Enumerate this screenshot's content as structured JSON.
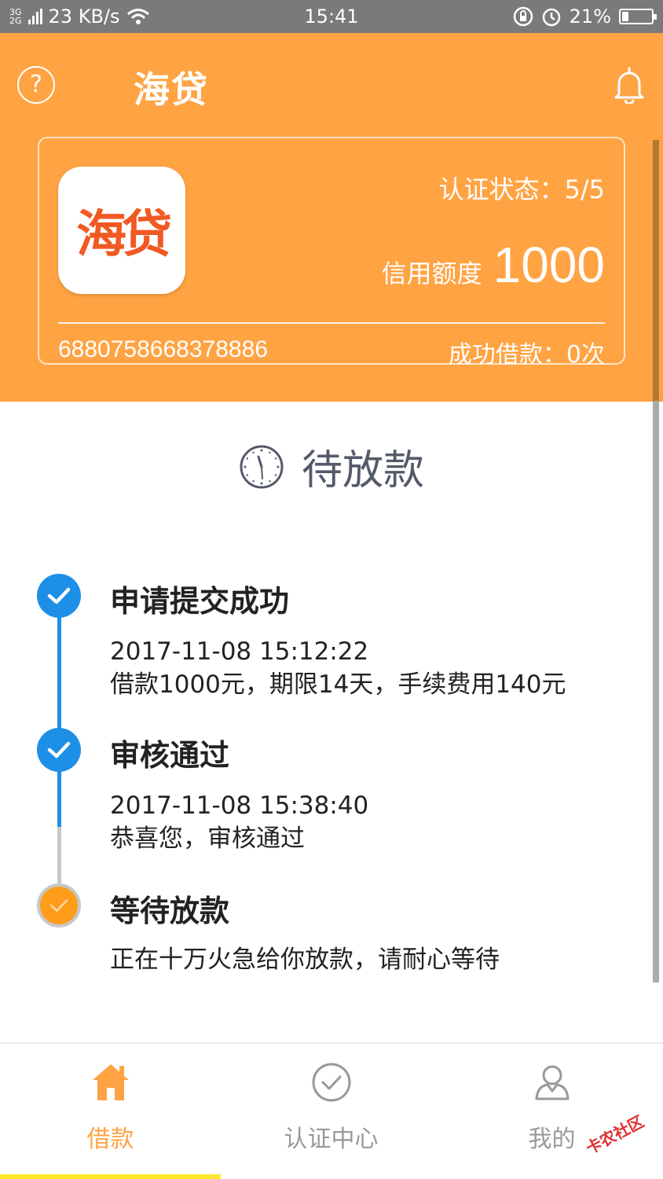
{
  "status_bar": {
    "net_top": "3G",
    "net_bottom": "2G",
    "speed": "23 KB/s",
    "time": "15:41",
    "battery": "21%",
    "battery_level": 0.21
  },
  "header": {
    "title": "海贷",
    "help_glyph": "?"
  },
  "card": {
    "logo_text": "海贷",
    "cert_status": "认证状态：5/5",
    "credit_label": "信用额度",
    "credit_value": "1000",
    "account_no": "6880758668378886",
    "loan_count": "成功借款：0次"
  },
  "pending": {
    "label": "待放款"
  },
  "timeline": [
    {
      "title": "申请提交成功",
      "time": "2017-11-08 15:12:22",
      "detail": "借款1000元，期限14天，手续费用140元",
      "state": "done"
    },
    {
      "title": "审核通过",
      "time": "2017-11-08 15:38:40",
      "detail": "恭喜您，审核通过",
      "state": "done"
    },
    {
      "title": "等待放款",
      "detail": "正在十万火急给你放款，请耐心等待",
      "state": "waiting"
    }
  ],
  "nav": [
    {
      "label": "借款",
      "icon": "home-icon",
      "active": true
    },
    {
      "label": "认证中心",
      "icon": "check-circle-icon",
      "active": false
    },
    {
      "label": "我的",
      "icon": "user-icon",
      "active": false
    }
  ],
  "watermark": "卡农社区",
  "colors": {
    "accent": "#ffa343",
    "timeline_blue": "#1e8fe6",
    "waiting_orange": "#ff9c1a",
    "nav_underline": "#ffe830"
  }
}
